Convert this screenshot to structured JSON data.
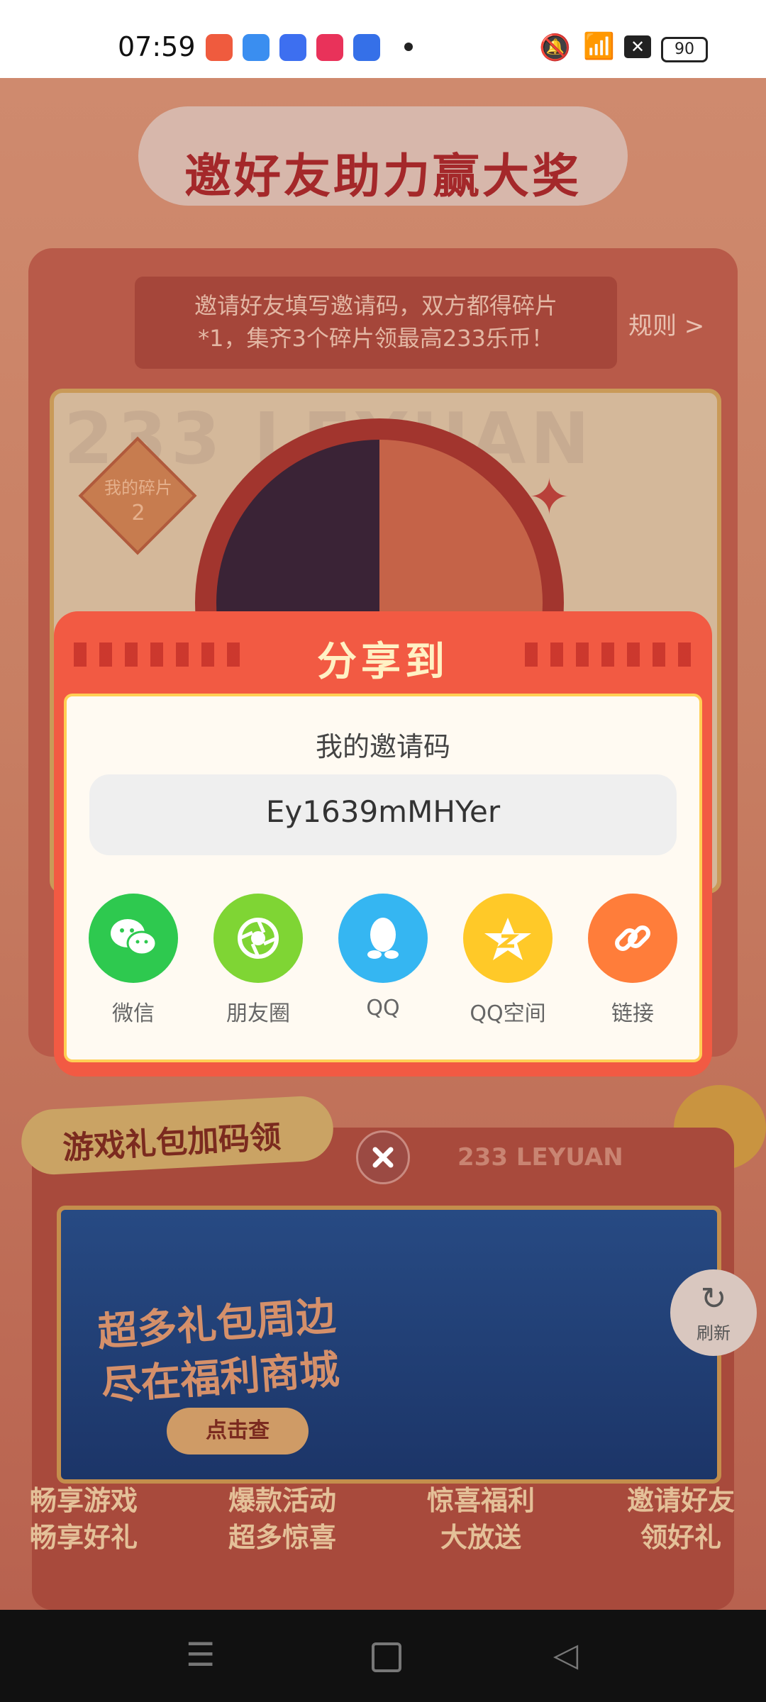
{
  "status_bar": {
    "time": "07:59",
    "battery": "90"
  },
  "page": {
    "title": "邀好友助力赢大奖",
    "rule_text_line1": "邀请好友填写邀请码，双方都得碎片",
    "rule_text_line2": "*1，集齐3个碎片领最高233乐币！",
    "rule_link": "规则 >",
    "background_brand": "233 LEYUAN",
    "fragments_label": "我的碎片",
    "fragments_count": "2",
    "gift_section_title": "游戏礼包加码领",
    "gift_section_brand": "233 LEYUAN",
    "banner_line1": "超多礼包周边",
    "banner_line2": "尽在福利商城",
    "banner_button": "点击查",
    "refresh_label": "刷新",
    "bottom_labels": [
      {
        "line1": "畅享游戏",
        "line2": "畅享好礼"
      },
      {
        "line1": "爆款活动",
        "line2": "超多惊喜"
      },
      {
        "line1": "惊喜福利",
        "line2": "大放送"
      },
      {
        "line1": "邀请好友",
        "line2": "领好礼"
      }
    ]
  },
  "modal": {
    "title": "分享到",
    "code_label": "我的邀请码",
    "invite_code": "Ey1639mMHYer",
    "share_targets": [
      {
        "label": "微信",
        "icon": "wechat-icon",
        "color": "#2ec94f"
      },
      {
        "label": "朋友圈",
        "icon": "moments-icon",
        "color": "#7fd534"
      },
      {
        "label": "QQ",
        "icon": "qq-icon",
        "color": "#35b6f2"
      },
      {
        "label": "QQ空间",
        "icon": "qzone-icon",
        "color": "#ffc928"
      },
      {
        "label": "链接",
        "icon": "link-icon",
        "color": "#ff7d3a"
      }
    ]
  }
}
